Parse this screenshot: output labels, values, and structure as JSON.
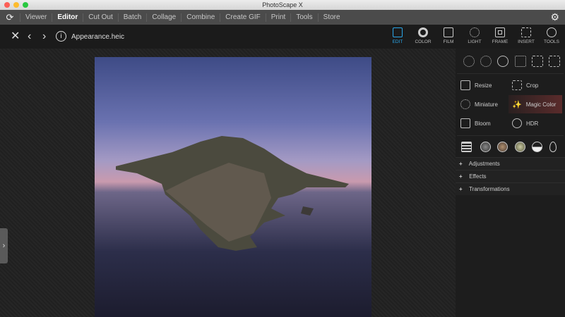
{
  "window": {
    "title": "PhotoScape X"
  },
  "menu": {
    "items": [
      "Viewer",
      "Editor",
      "Cut Out",
      "Batch",
      "Collage",
      "Combine",
      "Create GIF",
      "Print",
      "Tools",
      "Store"
    ],
    "active": "Editor"
  },
  "toolbar": {
    "filename": "Appearance.heic"
  },
  "tabs": [
    {
      "label": "EDIT"
    },
    {
      "label": "COLOR"
    },
    {
      "label": "FILM"
    },
    {
      "label": "LIGHT"
    },
    {
      "label": "FRAME"
    },
    {
      "label": "INSERT"
    },
    {
      "label": "TOOLS"
    }
  ],
  "tools": {
    "resize": "Resize",
    "crop": "Crop",
    "miniature": "Miniature",
    "magic_color": "Magic Color",
    "bloom": "Bloom",
    "hdr": "HDR"
  },
  "sections": [
    "Adjustments",
    "Effects",
    "Transformations"
  ],
  "colors": {
    "accent": "#2aa6e8",
    "highlight": "#5a2b2b"
  }
}
